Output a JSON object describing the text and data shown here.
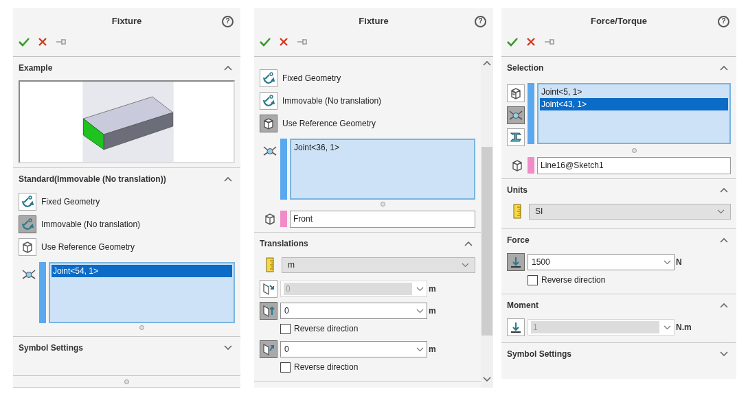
{
  "panels": [
    {
      "kind": "docked",
      "title": "Fixture",
      "help": "?",
      "sections": [
        {
          "title": "Example",
          "expanded": true
        },
        {
          "title": "Standard(Immovable (No translation))",
          "expanded": true,
          "rows": [
            {
              "kind": "options",
              "options": [
                {
                  "label": "Fixed Geometry",
                  "selected": false
                },
                {
                  "label": "Immovable (No translation)",
                  "selected": true
                },
                {
                  "label": "Use Reference Geometry",
                  "selected": false
                }
              ]
            },
            {
              "kind": "selection",
              "color": "#5aa8ee",
              "items": [
                {
                  "label": "Joint<54, 1>",
                  "selected": true
                }
              ]
            }
          ]
        },
        {
          "title": "Symbol Settings",
          "expanded": false
        }
      ]
    },
    {
      "kind": "scrolling",
      "title": "Fixture",
      "help": "?",
      "sections": [
        {
          "rows": [
            {
              "kind": "options",
              "options": [
                {
                  "label": "Fixed Geometry",
                  "selected": false
                },
                {
                  "label": "Immovable (No translation)",
                  "selected": false
                },
                {
                  "label": "Use Reference Geometry",
                  "selected": true
                }
              ]
            },
            {
              "kind": "selection",
              "color": "#5aa8ee",
              "items": [
                {
                  "label": "Joint<36, 1>",
                  "selected": false
                }
              ]
            },
            {
              "kind": "field",
              "color": "#f08cc8",
              "value": "Front"
            }
          ]
        },
        {
          "title": "Translations",
          "expanded": true,
          "rows": [
            {
              "kind": "dropdown",
              "value": "m"
            },
            {
              "kind": "value",
              "selected": false,
              "value": "0",
              "unit": "m",
              "disabled": true
            },
            {
              "kind": "value",
              "selected": true,
              "value": "0",
              "unit": "m",
              "disabled": false
            },
            {
              "kind": "checkbox",
              "label": "Reverse direction",
              "checked": false
            },
            {
              "kind": "value",
              "selected": true,
              "value": "0",
              "unit": "m",
              "disabled": false
            },
            {
              "kind": "checkbox",
              "label": "Reverse direction",
              "checked": false
            }
          ]
        }
      ]
    },
    {
      "kind": "plain",
      "title": "Force/Torque",
      "help": "?",
      "sections": [
        {
          "title": "Selection",
          "expanded": true,
          "rows": [
            {
              "kind": "selection",
              "color": "#5aa8ee",
              "buttons": [
                {
                  "selected": false
                },
                {
                  "selected": true
                },
                {
                  "selected": false
                }
              ],
              "items": [
                {
                  "label": "Joint<5, 1>",
                  "selected": false
                },
                {
                  "label": "Joint<43, 1>",
                  "selected": true
                }
              ]
            },
            {
              "kind": "field",
              "color": "#f08cc8",
              "value": "Line16@Sketch1"
            }
          ]
        },
        {
          "title": "Units",
          "expanded": true,
          "rows": [
            {
              "kind": "dropdown",
              "value": "SI"
            }
          ]
        },
        {
          "title": "Force",
          "expanded": true,
          "rows": [
            {
              "kind": "value",
              "selected": true,
              "value": "1500",
              "unit": "N",
              "disabled": false
            },
            {
              "kind": "checkbox",
              "label": "Reverse direction",
              "checked": false
            }
          ]
        },
        {
          "title": "Moment",
          "expanded": true,
          "rows": [
            {
              "kind": "value",
              "selected": false,
              "value": "1",
              "unit": "N.m",
              "disabled": true
            }
          ]
        },
        {
          "title": "Symbol Settings",
          "expanded": false
        }
      ]
    }
  ]
}
